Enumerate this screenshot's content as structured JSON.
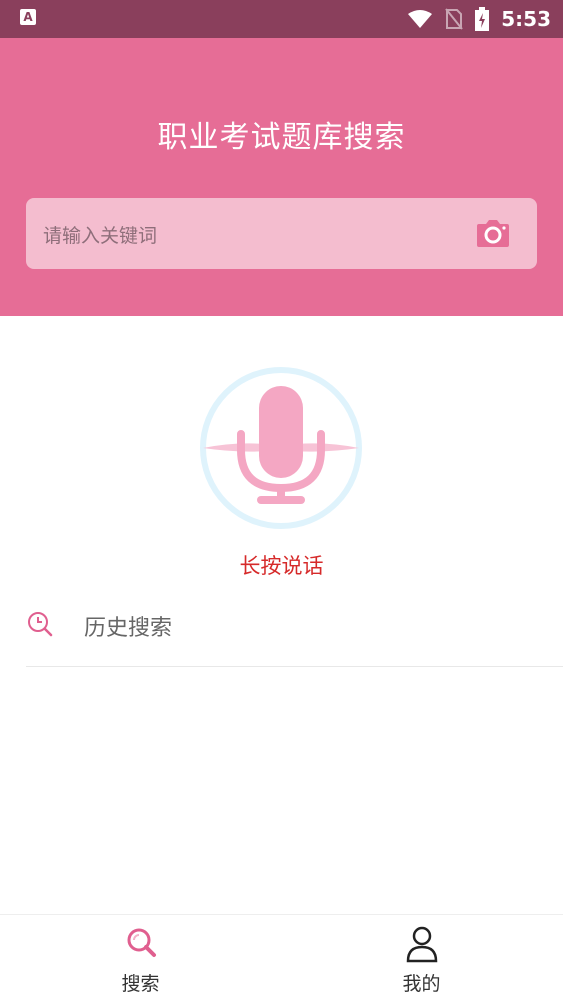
{
  "status_bar": {
    "time": "5:53",
    "left_icon_letter": "A"
  },
  "header": {
    "title": "职业考试题库搜索",
    "search_placeholder": "请输入关键词"
  },
  "voice": {
    "label": "长按说话"
  },
  "history": {
    "label": "历史搜索"
  },
  "bottom_nav": {
    "items": [
      {
        "label": "搜索",
        "icon": "search-icon",
        "active": true
      },
      {
        "label": "我的",
        "icon": "user-icon",
        "active": false
      }
    ]
  },
  "colors": {
    "header_bg": "#e66d96",
    "status_bar_bg": "#8a3f5c",
    "accent": "#e05f8f",
    "mic_pink": "#f4a7c3",
    "ring_blue": "#dff3fc",
    "voice_label": "#d62a2a"
  }
}
